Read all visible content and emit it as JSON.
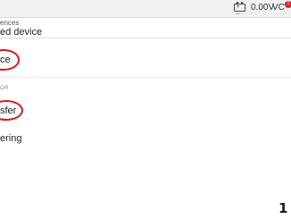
{
  "status_bar": {
    "battery_icon": "battery-icon",
    "voltage": "0.00V",
    "vci_label": "VC",
    "vci_badge": "!"
  },
  "header": {
    "subtitle": "ences",
    "title": "ed device"
  },
  "list": {
    "item_1": "ce",
    "section_label": "OR",
    "item_3": "sfer",
    "item_4": "ering"
  },
  "corner_logo": "1"
}
